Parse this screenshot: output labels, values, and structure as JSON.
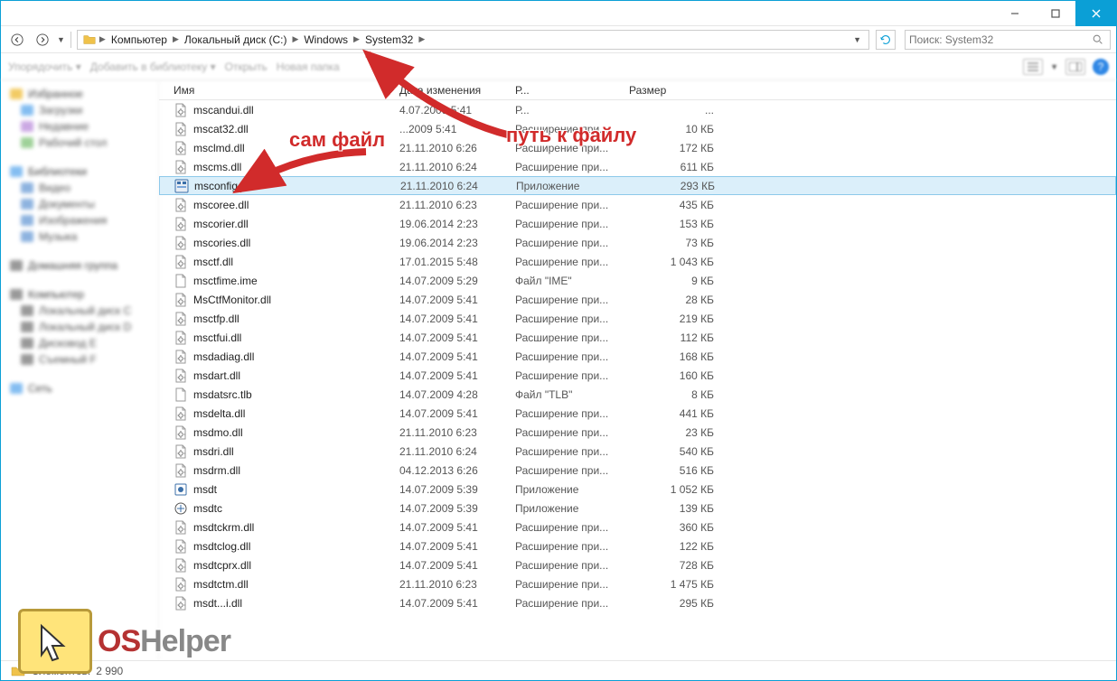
{
  "window": {
    "title": ""
  },
  "breadcrumb": {
    "crumbs": [
      "Компьютер",
      "Локальный диск (C:)",
      "Windows",
      "System32"
    ]
  },
  "search": {
    "placeholder": "Поиск: System32"
  },
  "columns": {
    "name": "Имя",
    "date": "Дата изменения",
    "type": "Р...",
    "size": "Размер"
  },
  "files": [
    {
      "name": "mscandui.dll",
      "date": "4.07.2009 5:41",
      "type": "Р...",
      "size": "..."
    },
    {
      "name": "mscat32.dll",
      "date": "...2009 5:41",
      "type": "Расширение при...",
      "size": "10 КБ"
    },
    {
      "name": "msclmd.dll",
      "date": "21.11.2010 6:26",
      "type": "Расширение при...",
      "size": "172 КБ"
    },
    {
      "name": "mscms.dll",
      "date": "21.11.2010 6:24",
      "type": "Расширение при...",
      "size": "611 КБ"
    },
    {
      "name": "msconfig",
      "date": "21.11.2010 6:24",
      "type": "Приложение",
      "size": "293 КБ",
      "selected": true,
      "icon": "app"
    },
    {
      "name": "mscoree.dll",
      "date": "21.11.2010 6:23",
      "type": "Расширение при...",
      "size": "435 КБ"
    },
    {
      "name": "mscorier.dll",
      "date": "19.06.2014 2:23",
      "type": "Расширение при...",
      "size": "153 КБ"
    },
    {
      "name": "mscories.dll",
      "date": "19.06.2014 2:23",
      "type": "Расширение при...",
      "size": "73 КБ"
    },
    {
      "name": "msctf.dll",
      "date": "17.01.2015 5:48",
      "type": "Расширение при...",
      "size": "1 043 КБ"
    },
    {
      "name": "msctfime.ime",
      "date": "14.07.2009 5:29",
      "type": "Файл \"IME\"",
      "size": "9 КБ",
      "icon": "file"
    },
    {
      "name": "MsCtfMonitor.dll",
      "date": "14.07.2009 5:41",
      "type": "Расширение при...",
      "size": "28 КБ"
    },
    {
      "name": "msctfp.dll",
      "date": "14.07.2009 5:41",
      "type": "Расширение при...",
      "size": "219 КБ"
    },
    {
      "name": "msctfui.dll",
      "date": "14.07.2009 5:41",
      "type": "Расширение при...",
      "size": "112 КБ"
    },
    {
      "name": "msdadiag.dll",
      "date": "14.07.2009 5:41",
      "type": "Расширение при...",
      "size": "168 КБ"
    },
    {
      "name": "msdart.dll",
      "date": "14.07.2009 5:41",
      "type": "Расширение при...",
      "size": "160 КБ"
    },
    {
      "name": "msdatsrc.tlb",
      "date": "14.07.2009 4:28",
      "type": "Файл \"TLB\"",
      "size": "8 КБ",
      "icon": "file"
    },
    {
      "name": "msdelta.dll",
      "date": "14.07.2009 5:41",
      "type": "Расширение при...",
      "size": "441 КБ"
    },
    {
      "name": "msdmo.dll",
      "date": "21.11.2010 6:23",
      "type": "Расширение при...",
      "size": "23 КБ"
    },
    {
      "name": "msdri.dll",
      "date": "21.11.2010 6:24",
      "type": "Расширение при...",
      "size": "540 КБ"
    },
    {
      "name": "msdrm.dll",
      "date": "04.12.2013 6:26",
      "type": "Расширение при...",
      "size": "516 КБ"
    },
    {
      "name": "msdt",
      "date": "14.07.2009 5:39",
      "type": "Приложение",
      "size": "1 052 КБ",
      "icon": "app2"
    },
    {
      "name": "msdtc",
      "date": "14.07.2009 5:39",
      "type": "Приложение",
      "size": "139 КБ",
      "icon": "app3"
    },
    {
      "name": "msdtckrm.dll",
      "date": "14.07.2009 5:41",
      "type": "Расширение при...",
      "size": "360 КБ"
    },
    {
      "name": "msdtclog.dll",
      "date": "14.07.2009 5:41",
      "type": "Расширение при...",
      "size": "122 КБ"
    },
    {
      "name": "msdtcprx.dll",
      "date": "14.07.2009 5:41",
      "type": "Расширение при...",
      "size": "728 КБ"
    },
    {
      "name": "msdtctm.dll",
      "date": "21.11.2010 6:23",
      "type": "Расширение при...",
      "size": "1 475 КБ"
    },
    {
      "name": "msdt...i.dll",
      "date": "14.07.2009 5:41",
      "type": "Расширение при...",
      "size": "295 КБ"
    }
  ],
  "status": {
    "label": "Элементов:",
    "count": "2 990"
  },
  "annotations": {
    "file_label": "сам файл",
    "path_label": "путь к файлу"
  },
  "watermark": {
    "text1": "OS",
    "text2": "Helper"
  }
}
